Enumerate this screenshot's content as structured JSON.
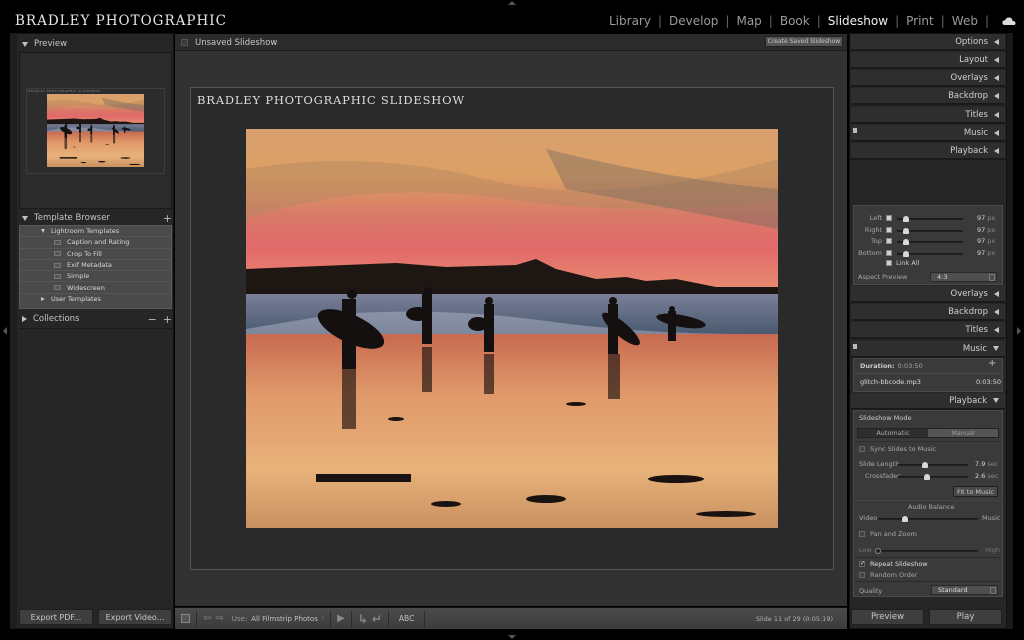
{
  "identity_plate": "BRADLEY PHOTOGRAPHIC",
  "modules": [
    {
      "label": "Library",
      "active": false
    },
    {
      "label": "Develop",
      "active": false
    },
    {
      "label": "Map",
      "active": false
    },
    {
      "label": "Book",
      "active": false
    },
    {
      "label": "Slideshow",
      "active": true
    },
    {
      "label": "Print",
      "active": false
    },
    {
      "label": "Web",
      "active": false
    }
  ],
  "left_panel": {
    "preview_header": "Preview",
    "template_browser": {
      "header": "Template Browser",
      "folder": "Lightroom Templates",
      "templates": [
        "Caption and Rating",
        "Crop To Fill",
        "Exif Metadata",
        "Simple",
        "Widescreen"
      ],
      "user_folder": "User Templates"
    },
    "collections_header": "Collections",
    "export_pdf": "Export PDF...",
    "export_video": "Export Video..."
  },
  "center": {
    "slideshow_name": "Unsaved Slideshow",
    "create_saved": "Create Saved Slideshow",
    "slide_title": "BRADLEY PHOTOGRAPHIC SLIDESHOW",
    "toolbar": {
      "use_label": "Use:",
      "use_value": "All Filmstrip Photos",
      "abc": "ABC",
      "slide_info": "Slide 11 of 29 (0:05:19)"
    }
  },
  "right_panel": {
    "collapsed_sections": [
      "Options",
      "Layout",
      "Overlays",
      "Backdrop",
      "Titles",
      "Music",
      "Playback"
    ],
    "layout": {
      "guides": [
        {
          "label": "Left",
          "value": "97",
          "unit": "px"
        },
        {
          "label": "Right",
          "value": "97",
          "unit": "px"
        },
        {
          "label": "Top",
          "value": "97",
          "unit": "px"
        },
        {
          "label": "Bottom",
          "value": "97",
          "unit": "px"
        }
      ],
      "link_all": "Link All",
      "aspect_label": "Aspect Preview",
      "aspect_value": "4:3"
    },
    "sections_mid": [
      "Overlays",
      "Backdrop",
      "Titles"
    ],
    "music": {
      "header": "Music",
      "duration_label": "Duration:",
      "duration_value": "0:03:50",
      "track_name": "glitch-bbcode.mp3",
      "track_time": "0:03:50"
    },
    "playback": {
      "header": "Playback",
      "mode_label": "Slideshow Mode",
      "mode_options": [
        "Automatic",
        "Manual"
      ],
      "mode_selected": "Automatic",
      "sync_label": "Sync Slides to Music",
      "sync_checked": false,
      "slide_length_label": "Slide Length",
      "slide_length_value": "7.9",
      "slide_length_fraction": 0.38,
      "crossfades_label": "Crossfades",
      "crossfades_value": "2.6",
      "crossfades_fraction": 0.42,
      "sec_unit": "sec",
      "fit_to_music": "Fit to Music",
      "audio_balance_label": "Audio Balance",
      "video_label": "Video",
      "music_label": "Music",
      "audio_balance_fraction": 0.27,
      "pan_zoom_label": "Pan and Zoom",
      "pan_zoom_checked": false,
      "low_label": "Low",
      "high_label": "High",
      "pan_zoom_fraction": 0.0,
      "repeat_label": "Repeat Slideshow",
      "repeat_checked": true,
      "random_label": "Random Order",
      "random_checked": false,
      "quality_label": "Quality",
      "quality_value": "Standard"
    },
    "preview_button": "Preview",
    "play_button": "Play"
  }
}
